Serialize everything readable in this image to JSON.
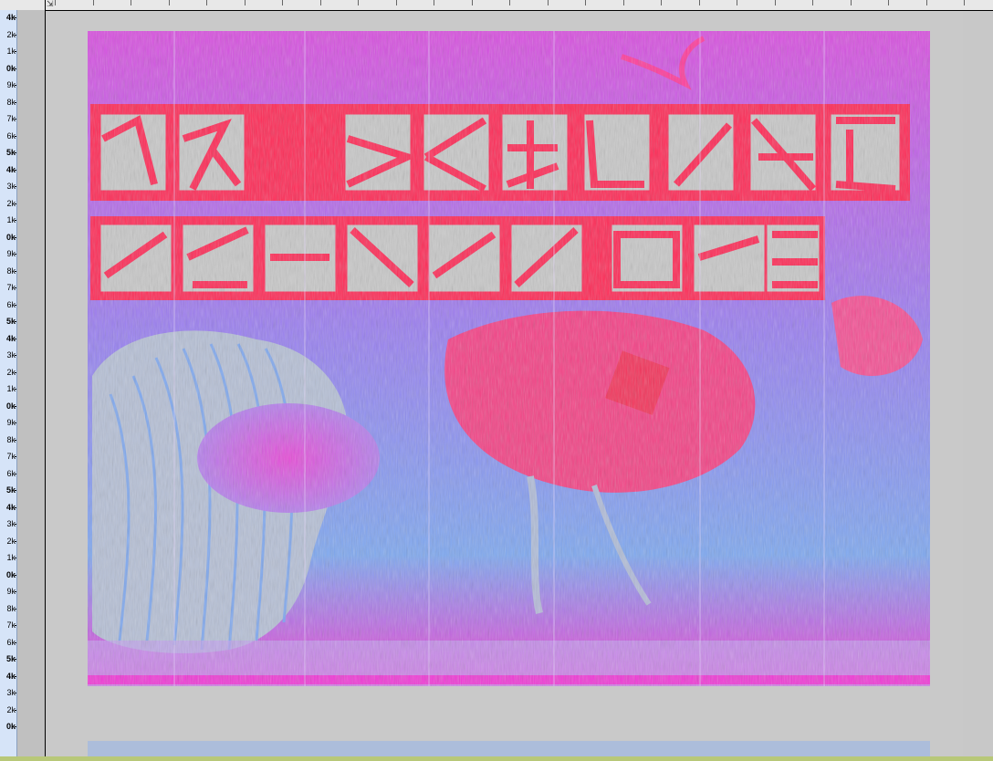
{
  "ruler": {
    "freq_labels": [
      "4k",
      "2k",
      "1k",
      "0k",
      "9k",
      "8k",
      "7k",
      "6k",
      "5k",
      "4k",
      "3k",
      "2k",
      "1k",
      "0k",
      "9k",
      "8k",
      "7k",
      "6k",
      "5k",
      "4k",
      "3k",
      "2k",
      "1k",
      "0k",
      "9k",
      "8k",
      "7k",
      "6k",
      "5k",
      "4k",
      "3k",
      "2k",
      "1k",
      "0k",
      "9k",
      "8k",
      "7k",
      "6k",
      "5k",
      "4k",
      "3k",
      "2k",
      "0k"
    ],
    "major_labels": [
      "4k",
      "0k",
      "5k"
    ]
  },
  "colors": {
    "background": "#c9c9c9",
    "spectro_blue": "#7aa6f2",
    "spectro_magenta": "#f03ad6",
    "spectro_red": "#ff2a4a",
    "ruler_bg": "#d6e4f8"
  }
}
